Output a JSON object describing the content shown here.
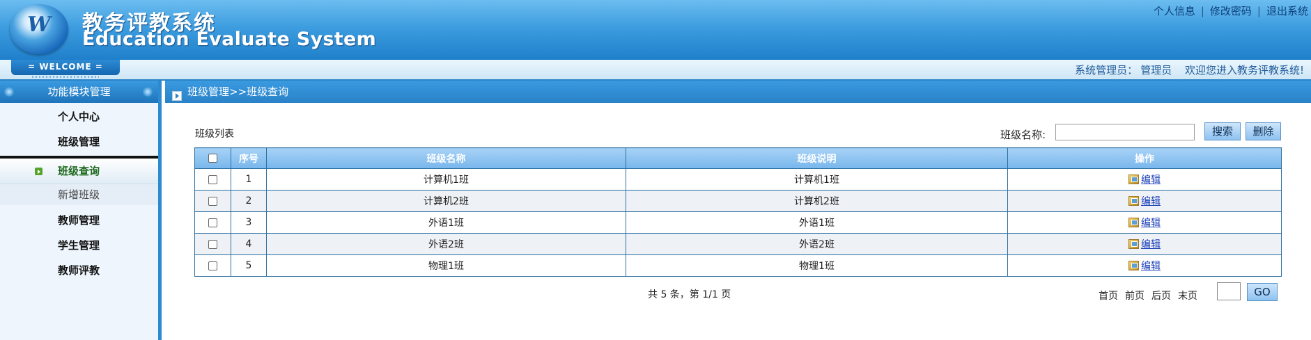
{
  "header": {
    "title_cn": "教务评教系统",
    "title_en": "Education Evaluate System",
    "logo_letter": "W",
    "links": [
      "个人信息",
      "修改密码",
      "退出系统"
    ],
    "link_separator": "|"
  },
  "welcome": {
    "tab_label": "= WELCOME =",
    "role_label": "系统管理员：",
    "user_name": "管理员",
    "greeting": "欢迎您进入教务评教系统!"
  },
  "sidebar": {
    "title": "功能模块管理",
    "items": [
      {
        "label": "个人中心"
      },
      {
        "label": "班级管理"
      },
      {
        "label": "班级查询",
        "active": true
      },
      {
        "label": "新增班级"
      },
      {
        "label": "教师管理"
      },
      {
        "label": "学生管理"
      },
      {
        "label": "教师评教"
      }
    ]
  },
  "main": {
    "breadcrumb": "班级管理>>班级查询",
    "list_title": "班级列表",
    "search_label": "班级名称:",
    "search_value": "",
    "search_button": "搜索",
    "delete_button": "删除",
    "columns": [
      "",
      "序号",
      "班级名称",
      "班级说明",
      "操作"
    ],
    "rows": [
      {
        "no": "1",
        "name": "计算机1班",
        "desc": "计算机1班",
        "action": "编辑"
      },
      {
        "no": "2",
        "name": "计算机2班",
        "desc": "计算机2班",
        "action": "编辑"
      },
      {
        "no": "3",
        "name": "外语1班",
        "desc": "外语1班",
        "action": "编辑"
      },
      {
        "no": "4",
        "name": "外语2班",
        "desc": "外语2班",
        "action": "编辑"
      },
      {
        "no": "5",
        "name": "物理1班",
        "desc": "物理1班",
        "action": "编辑"
      }
    ],
    "pager": {
      "summary": "共 5 条，第 1/1 页",
      "first": "首页",
      "prev": "前页",
      "next": "后页",
      "last": "末页",
      "go_button": "GO",
      "page_input_value": ""
    }
  },
  "colors": {
    "header_blue": "#2a82c8",
    "active_green": "#1e6a1e",
    "link_blue": "#1a3fb8"
  }
}
